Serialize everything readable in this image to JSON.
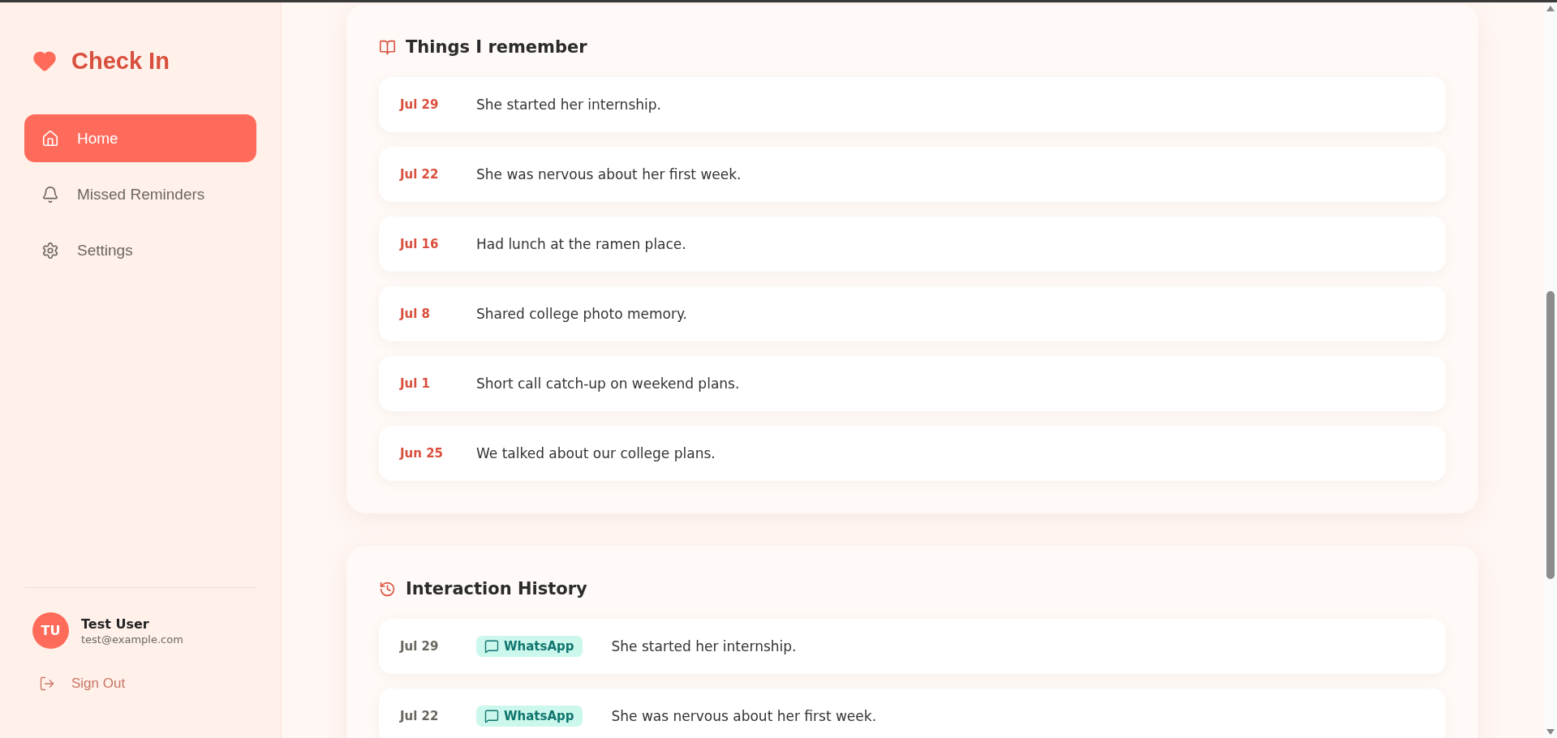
{
  "app": {
    "title": "Check In"
  },
  "nav": [
    {
      "label": "Home",
      "kind": "home",
      "selected": true
    },
    {
      "label": "Missed Reminders",
      "kind": "bell",
      "selected": false
    },
    {
      "label": "Settings",
      "kind": "settings",
      "selected": false
    }
  ],
  "user": {
    "initials": "TU",
    "name": "Test User",
    "email": "test@example.com"
  },
  "sign_out": "Sign Out",
  "memories": {
    "title": "Things I remember",
    "items": [
      {
        "date": "Jul 29",
        "text": "She started her internship."
      },
      {
        "date": "Jul 22",
        "text": "She was nervous about her first week."
      },
      {
        "date": "Jul 16",
        "text": "Had lunch at the ramen place."
      },
      {
        "date": "Jul 8",
        "text": "Shared college photo memory."
      },
      {
        "date": "Jul 1",
        "text": "Short call catch-up on weekend plans."
      },
      {
        "date": "Jun 25",
        "text": "We talked about our college plans."
      }
    ]
  },
  "history": {
    "title": "Interaction History",
    "items": [
      {
        "date": "Jul 29",
        "channel": "WhatsApp",
        "text": "She started her internship."
      },
      {
        "date": "Jul 22",
        "channel": "WhatsApp",
        "text": "She was nervous about her first week."
      }
    ]
  }
}
